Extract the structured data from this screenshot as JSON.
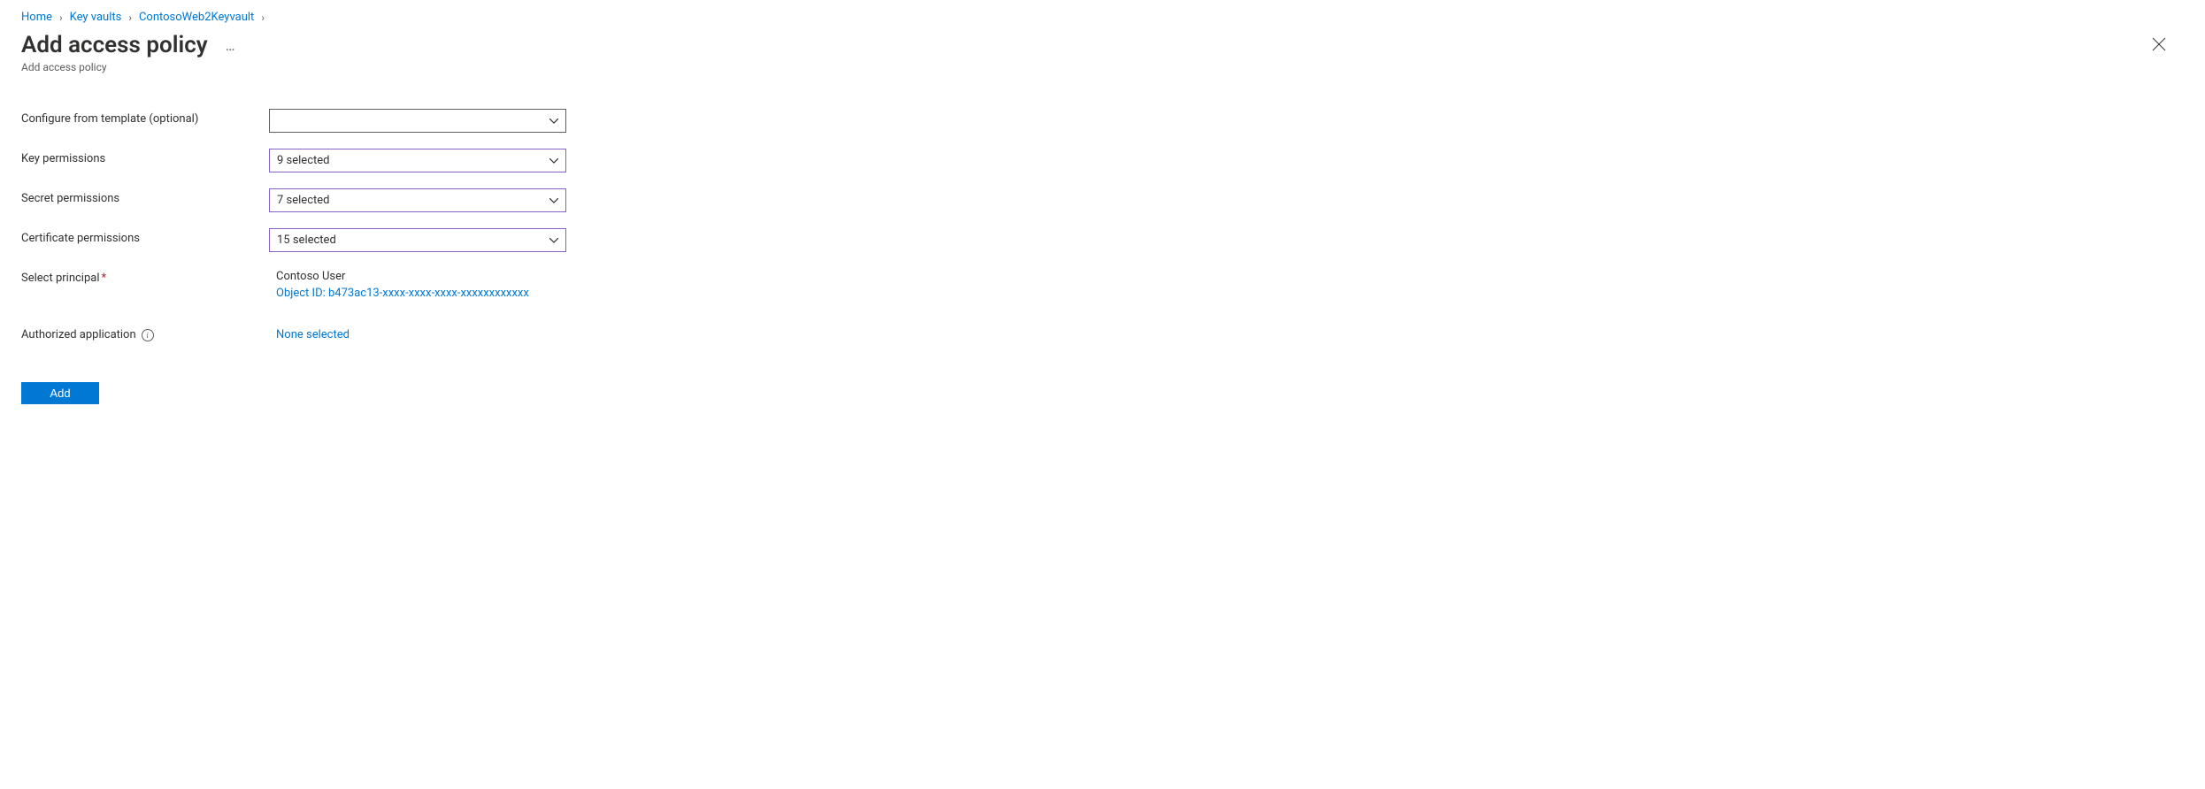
{
  "breadcrumb": {
    "items": [
      {
        "label": "Home"
      },
      {
        "label": "Key vaults"
      },
      {
        "label": "ContosoWeb2Keyvault"
      }
    ]
  },
  "header": {
    "title": "Add access policy",
    "subtitle": "Add access policy"
  },
  "form": {
    "template": {
      "label": "Configure from template (optional)",
      "value": ""
    },
    "keyPermissions": {
      "label": "Key permissions",
      "value": "9 selected"
    },
    "secretPermissions": {
      "label": "Secret permissions",
      "value": "7 selected"
    },
    "certificatePermissions": {
      "label": "Certificate permissions",
      "value": "15 selected"
    },
    "selectPrincipal": {
      "label": "Select principal",
      "principalName": "Contoso User",
      "objectIdLabel": "Object ID: b473ac13-xxxx-xxxx-xxxx-xxxxxxxxxxxx"
    },
    "authorizedApplication": {
      "label": "Authorized application",
      "value": "None selected"
    }
  },
  "actions": {
    "add": "Add"
  }
}
